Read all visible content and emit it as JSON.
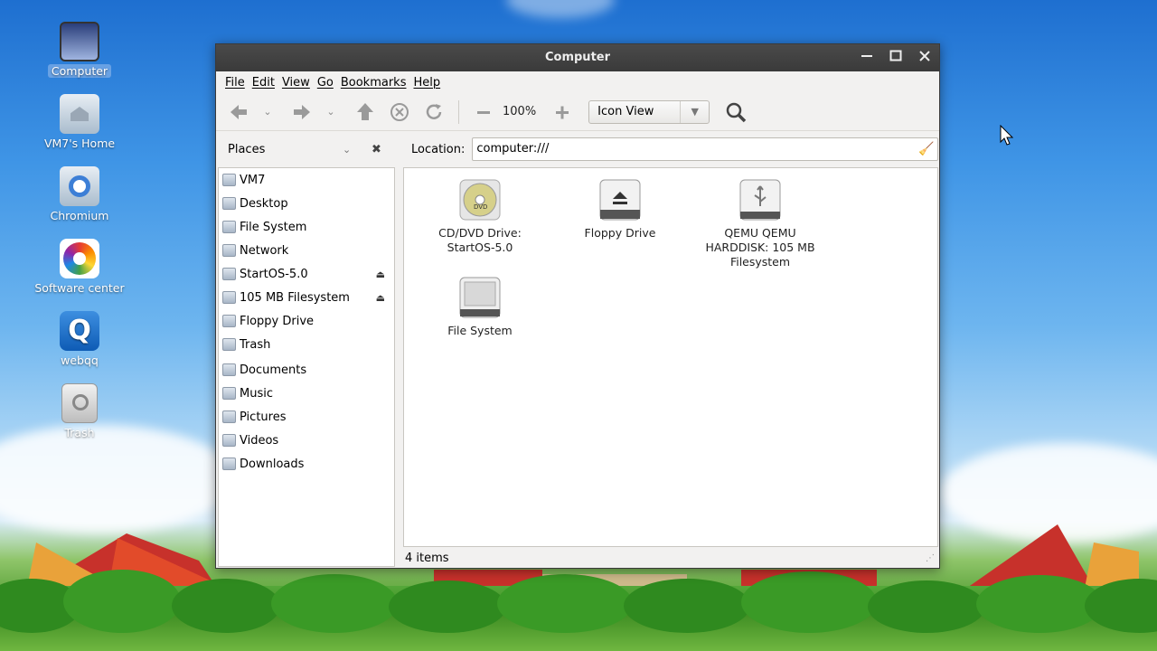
{
  "desktop": {
    "icons": [
      {
        "label": "Computer",
        "icon": "computer-icon"
      },
      {
        "label": "VM7's Home",
        "icon": "home-folder-icon"
      },
      {
        "label": "Chromium",
        "icon": "chromium-icon"
      },
      {
        "label": "Software center",
        "icon": "software-center-icon"
      },
      {
        "label": "webqq",
        "icon": "webqq-icon"
      },
      {
        "label": "Trash",
        "icon": "trash-icon"
      }
    ]
  },
  "window": {
    "title": "Computer",
    "menu": [
      "File",
      "Edit",
      "View",
      "Go",
      "Bookmarks",
      "Help"
    ],
    "toolbar": {
      "zoom": "100%",
      "view_mode": "Icon View"
    },
    "places_label": "Places",
    "location_label": "Location:",
    "location_value": "computer:///",
    "sidebar": [
      {
        "label": "VM7"
      },
      {
        "label": "Desktop"
      },
      {
        "label": "File System"
      },
      {
        "label": "Network"
      },
      {
        "label": "StartOS-5.0",
        "eject": "⏏"
      },
      {
        "label": "105 MB Filesystem",
        "eject": "⏏"
      },
      {
        "label": "Floppy Drive"
      },
      {
        "label": "Trash"
      },
      {
        "label": "Documents"
      },
      {
        "label": "Music"
      },
      {
        "label": "Pictures"
      },
      {
        "label": "Videos"
      },
      {
        "label": "Downloads"
      }
    ],
    "items": [
      {
        "label": "CD/DVD Drive: StartOS-5.0",
        "icon": "dvd-drive-icon"
      },
      {
        "label": "Floppy Drive",
        "icon": "floppy-drive-icon"
      },
      {
        "label": "QEMU QEMU HARDDISK: 105 MB Filesystem",
        "icon": "usb-drive-icon"
      },
      {
        "label": "File System",
        "icon": "hard-disk-icon"
      }
    ],
    "status": "4 items"
  }
}
